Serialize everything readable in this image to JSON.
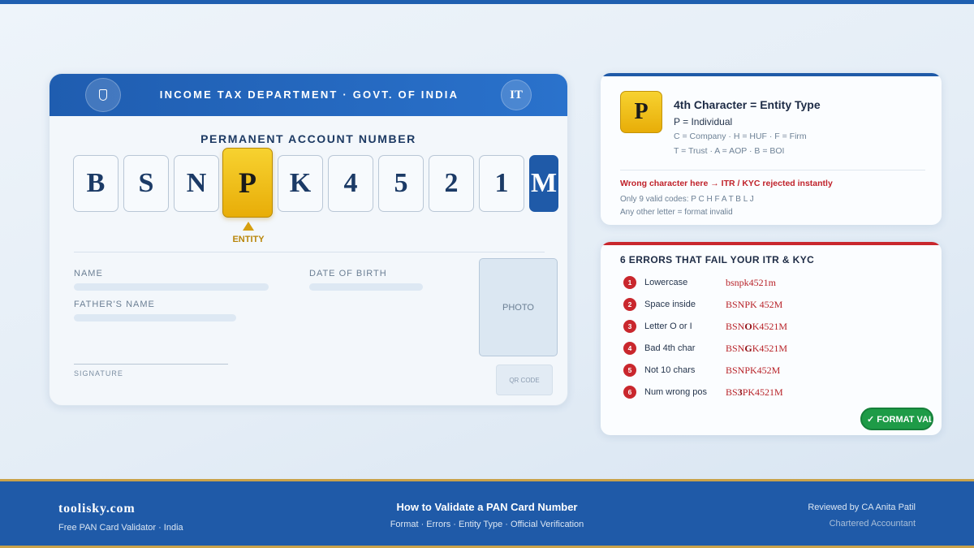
{
  "card": {
    "header_title": "INCOME TAX DEPARTMENT · GOVT. OF INDIA",
    "badge": "IT",
    "label": "PERMANENT ACCOUNT NUMBER",
    "pan_chars": [
      "B",
      "S",
      "N",
      "P",
      "K",
      "4",
      "5",
      "2",
      "1",
      "M"
    ],
    "entity_tag": "ENTITY",
    "fields": {
      "name": "NAME",
      "dob": "DATE OF BIRTH",
      "father": "FATHER'S NAME",
      "signature": "SIGNATURE",
      "photo": "PHOTO",
      "qr": "QR CODE"
    }
  },
  "entity_panel": {
    "letter": "P",
    "title": "4th Character = Entity Type",
    "line1": "P = Individual",
    "line2": "C = Company · H = HUF · F = Firm",
    "line3": "T = Trust · A = AOP · B = BOI",
    "warning": "Wrong character here → ITR / KYC rejected instantly",
    "note1": "Only 9 valid codes: P C H F A T B L J",
    "note2": "Any other letter = format invalid"
  },
  "errors_panel": {
    "title": "6 ERRORS THAT FAIL YOUR ITR & KYC",
    "errors": [
      {
        "num": "1",
        "label": "Lowercase",
        "pre": "bsnpk4521m",
        "bold": "",
        "post": ""
      },
      {
        "num": "2",
        "label": "Space inside",
        "pre": "BSNPK 452M",
        "bold": "",
        "post": ""
      },
      {
        "num": "3",
        "label": "Letter O or I",
        "pre": "BSN",
        "bold": "O",
        "post": "K4521M"
      },
      {
        "num": "4",
        "label": "Bad 4th char",
        "pre": "BSN",
        "bold": "G",
        "post": "K4521M"
      },
      {
        "num": "5",
        "label": "Not 10 chars",
        "pre": "BSNPK452M",
        "bold": "",
        "post": ""
      },
      {
        "num": "6",
        "label": "Num wrong pos",
        "pre": "BS",
        "bold": "3",
        "post": "PK4521M"
      }
    ],
    "badge": "✓ FORMAT VALID"
  },
  "footer": {
    "site": "toolisky.com",
    "site_sub": "Free PAN Card Validator · India",
    "title": "How to Validate a PAN Card Number",
    "subtitle": "Format · Errors · Entity Type · Official Verification",
    "reviewer": "Reviewed by CA Anita Patil",
    "role": "Chartered Accountant"
  },
  "colors": {
    "primary_blue": "#1f5aa8",
    "entity_gold": "#f0c01c",
    "error_red": "#c9272d",
    "valid_green": "#1e9b47"
  },
  "icons": {
    "emblem": "shield-emblem-icon"
  }
}
